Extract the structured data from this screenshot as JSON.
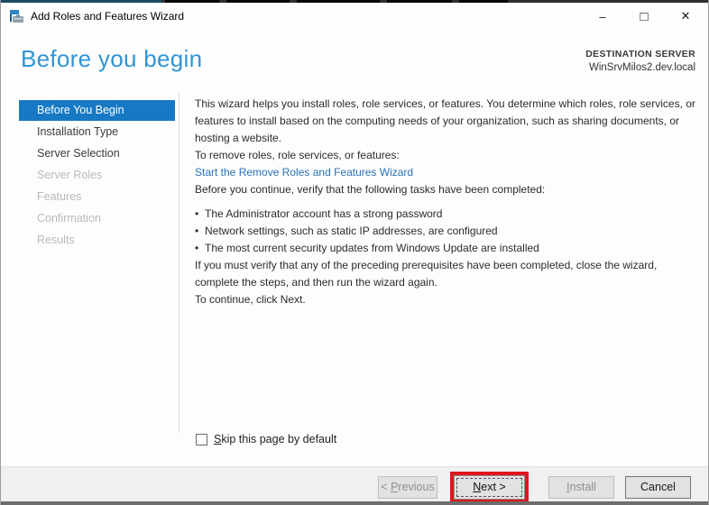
{
  "window": {
    "title": "Add Roles and Features Wizard",
    "controls": {
      "minimize": "–",
      "maximize": "□",
      "close": "✕"
    }
  },
  "header": {
    "title": "Before you begin",
    "destination_label": "DESTINATION SERVER",
    "destination_server": "WinSrvMilos2.dev.local"
  },
  "sidebar": {
    "items": [
      {
        "label": "Before You Begin",
        "state": "selected"
      },
      {
        "label": "Installation Type",
        "state": "enabled"
      },
      {
        "label": "Server Selection",
        "state": "enabled"
      },
      {
        "label": "Server Roles",
        "state": "disabled"
      },
      {
        "label": "Features",
        "state": "disabled"
      },
      {
        "label": "Confirmation",
        "state": "disabled"
      },
      {
        "label": "Results",
        "state": "disabled"
      }
    ]
  },
  "content": {
    "intro": "This wizard helps you install roles, role services, or features. You determine which roles, role services, or features to install based on the computing needs of your organization, such as sharing documents, or hosting a website.",
    "remove_line": "To remove roles, role services, or features:",
    "remove_link": "Start the Remove Roles and Features Wizard",
    "verify_line": "Before you continue, verify that the following tasks have been completed:",
    "bullet_char": "•",
    "bullets": [
      "The Administrator account has a strong password",
      "Network settings, such as static IP addresses, are configured",
      "The most current security updates from Windows Update are installed"
    ],
    "prereq_line": "If you must verify that any of the preceding prerequisites have been completed, close the wizard, complete the steps, and then run the wizard again.",
    "continue_line": "To continue, click Next.",
    "skip_checkbox": {
      "key": "S",
      "rest": "kip this page by default",
      "checked": false
    }
  },
  "footer": {
    "previous": {
      "pre": "< ",
      "key": "P",
      "rest": "revious",
      "enabled": false
    },
    "next": {
      "pre": "",
      "key": "N",
      "rest": "ext >",
      "enabled": true
    },
    "install": {
      "pre": "",
      "key": "I",
      "rest": "nstall",
      "enabled": false
    },
    "cancel": {
      "label": "Cancel",
      "enabled": true
    }
  },
  "colors": {
    "selected_blue": "#1779c4",
    "heading_blue": "#3095d4",
    "link_blue": "#2a72b5",
    "highlight_red": "#e0161c",
    "footer_gray": "#f0f0f0"
  }
}
